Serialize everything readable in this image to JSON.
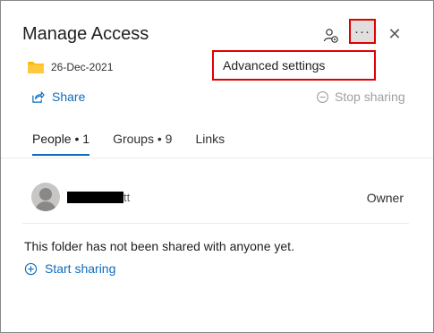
{
  "dialog": {
    "title": "Manage Access",
    "folder": {
      "date": "26-Dec-2021"
    },
    "actions": {
      "share": "Share",
      "stop_sharing": "Stop sharing"
    },
    "more_glyph": "···",
    "close_glyph": "✕",
    "menu": {
      "items": [
        "Advanced settings"
      ]
    },
    "tabs": [
      {
        "label": "People • 1",
        "active": true
      },
      {
        "label": "Groups • 9",
        "active": false
      },
      {
        "label": "Links",
        "active": false
      }
    ],
    "people": [
      {
        "name_visible": "tt",
        "role": "Owner"
      }
    ],
    "empty_message": "This folder has not been shared with anyone yet.",
    "start_sharing": "Start sharing"
  },
  "colors": {
    "accent": "#0f6cbd",
    "highlight_border": "#e00000",
    "folder": "#ffb900",
    "disabled_text": "#a19f9d"
  }
}
